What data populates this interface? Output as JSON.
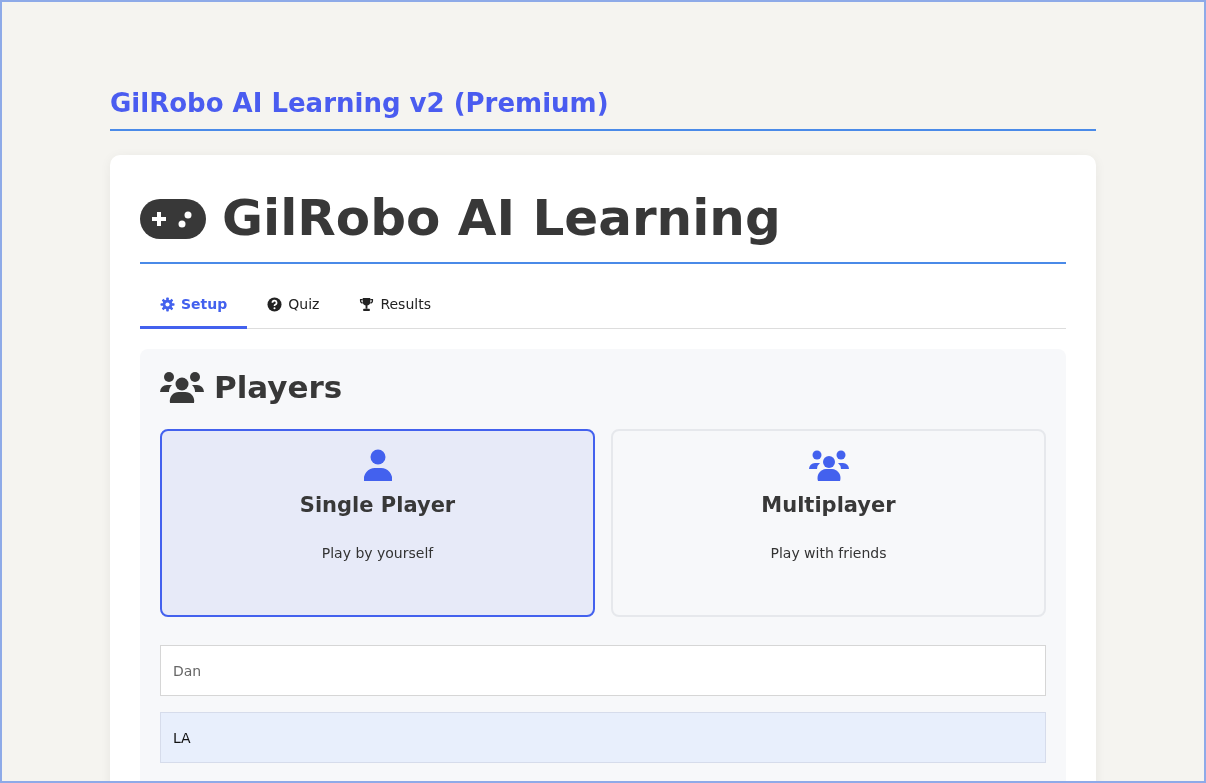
{
  "page_title": "GilRobo AI Learning v2 (Premium)",
  "app_title": "GilRobo AI Learning",
  "tabs": [
    {
      "label": "Setup",
      "kind": "gear",
      "selected": true
    },
    {
      "label": "Quiz",
      "kind": "question",
      "selected": false
    },
    {
      "label": "Results",
      "kind": "trophy",
      "selected": false
    }
  ],
  "section": {
    "title": "Players",
    "modes": [
      {
        "title": "Single Player",
        "subtitle": "Play by yourself",
        "kind": "user",
        "selected": true
      },
      {
        "title": "Multiplayer",
        "subtitle": "Play with friends",
        "kind": "users",
        "selected": false
      }
    ],
    "name_field": {
      "placeholder": "Dan"
    },
    "location_field": {
      "value": "LA"
    }
  }
}
